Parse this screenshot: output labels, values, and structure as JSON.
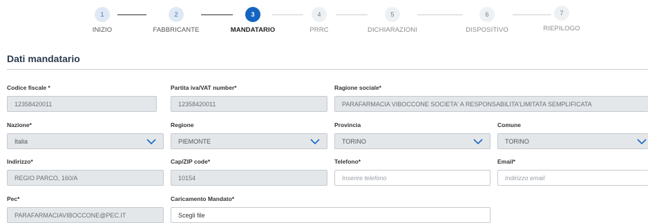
{
  "stepper": {
    "steps": [
      {
        "number": "1",
        "label": "INIZIO"
      },
      {
        "number": "2",
        "label": "FABBRICANTE"
      },
      {
        "number": "3",
        "label": "MANDATARIO"
      },
      {
        "number": "4",
        "label": "PRRC"
      },
      {
        "number": "5",
        "label": "DICHIARAZIONI"
      },
      {
        "number": "6",
        "label": "DISPOSITIVO"
      },
      {
        "number": "7",
        "label": "RIEPILOGO"
      }
    ]
  },
  "section": {
    "title": "Dati mandatario"
  },
  "form": {
    "codice_fiscale": {
      "label": "Codice fiscale *",
      "value": "12358420011"
    },
    "partita_iva": {
      "label": "Partita iva/VAT number*",
      "value": "12358420011"
    },
    "ragione_sociale": {
      "label": "Ragione sociale*",
      "value": "PARAFARMACIA VIBOCCONE SOCIETA' A RESPONSABILITA'LIMITATA SEMPLIFICATA"
    },
    "nazione": {
      "label": "Nazione*",
      "value": "Italia"
    },
    "regione": {
      "label": "Regione",
      "value": "PIEMONTE"
    },
    "provincia": {
      "label": "Provincia",
      "value": "TORINO"
    },
    "comune": {
      "label": "Comune",
      "value": "TORINO"
    },
    "indirizzo": {
      "label": "Indirizzo*",
      "value": "REGIO PARCO, 160/A"
    },
    "cap": {
      "label": "Cap/ZIP code*",
      "value": "10154"
    },
    "telefono": {
      "label": "Telefono*",
      "placeholder": "Inserire telefono"
    },
    "email": {
      "label": "Email*",
      "placeholder": "Indirizzo email"
    },
    "pec": {
      "label": "Pec*",
      "value": "PARAFARMACIAVIBOCCONE@PEC.IT"
    },
    "caricamento": {
      "label": "Caricamento Mandato*",
      "value": "Scegli file"
    }
  },
  "colors": {
    "active": "#1565c0",
    "readonly_bg": "#e4e7ea",
    "chevron": "#1565c0"
  }
}
